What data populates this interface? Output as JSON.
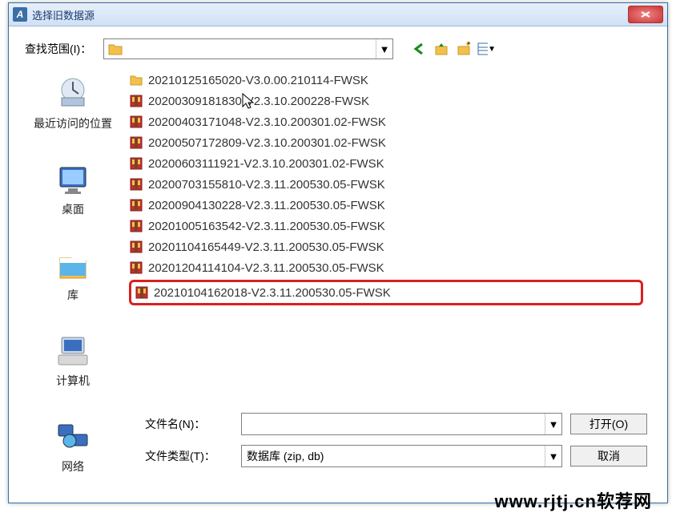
{
  "dialog": {
    "title": "选择旧数据源"
  },
  "lookIn": {
    "label": "查找范围(I)：",
    "currentFolder": ""
  },
  "toolbarIcons": {
    "back": "back-icon",
    "up": "up-folder-icon",
    "newFolder": "new-folder-icon",
    "views": "views-icon"
  },
  "places": [
    {
      "label": "最近访问的位置",
      "icon": "recent-places-icon"
    },
    {
      "label": "桌面",
      "icon": "desktop-icon"
    },
    {
      "label": "库",
      "icon": "libraries-icon"
    },
    {
      "label": "计算机",
      "icon": "computer-icon"
    },
    {
      "label": "网络",
      "icon": "network-icon"
    }
  ],
  "files": [
    {
      "name": "20210125165020-V3.0.00.210114-FWSK",
      "icon": "folder"
    },
    {
      "name": "20200309181830-V2.3.10.200228-FWSK",
      "icon": "archive"
    },
    {
      "name": "20200403171048-V2.3.10.200301.02-FWSK",
      "icon": "archive"
    },
    {
      "name": "20200507172809-V2.3.10.200301.02-FWSK",
      "icon": "archive"
    },
    {
      "name": "20200603111921-V2.3.10.200301.02-FWSK",
      "icon": "archive"
    },
    {
      "name": "20200703155810-V2.3.11.200530.05-FWSK",
      "icon": "archive"
    },
    {
      "name": "20200904130228-V2.3.11.200530.05-FWSK",
      "icon": "archive"
    },
    {
      "name": "20201005163542-V2.3.11.200530.05-FWSK",
      "icon": "archive"
    },
    {
      "name": "20201104165449-V2.3.11.200530.05-FWSK",
      "icon": "archive"
    },
    {
      "name": "20201204114104-V2.3.11.200530.05-FWSK",
      "icon": "archive"
    },
    {
      "name": "20210104162018-V2.3.11.200530.05-FWSK",
      "icon": "archive",
      "highlighted": true
    }
  ],
  "fileName": {
    "label": "文件名(N)：",
    "value": ""
  },
  "fileType": {
    "label": "文件类型(T)：",
    "value": "数据库 (zip, db)"
  },
  "buttons": {
    "open": "打开(O)",
    "cancel": "取消"
  },
  "watermark": "www.rjtj.cn软荐网"
}
